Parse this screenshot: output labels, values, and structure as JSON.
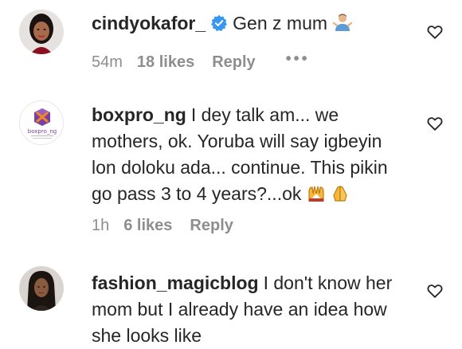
{
  "comments": [
    {
      "username": "cindyokafor_",
      "verified": true,
      "text": "Gen z mum",
      "emoji": "person-shrugging-emoji",
      "time": "54m",
      "likes": "18 likes",
      "reply": "Reply",
      "more": "•••"
    },
    {
      "username": "boxpro_ng",
      "avatar_logo_text": "boxpro_ng",
      "text": "I dey talk am... we mothers, ok. Yoruba will say igbeyin lon doloku ada... continue. This pikin go pass 3 to 4 years?...ok",
      "emoji": "raised-hands-emoji praying-hands-emoji",
      "time": "1h",
      "likes": "6 likes",
      "reply": "Reply"
    },
    {
      "username": "fashion_magicblog",
      "text": "I don't know her mom but I already have an idea how she looks like"
    }
  ],
  "colors": {
    "text": "#262626",
    "secondary": "#8e8e8e",
    "verified_blue": "#3897f0",
    "logo_purple": "#7b3fa0",
    "logo_orange": "#f08a24"
  }
}
